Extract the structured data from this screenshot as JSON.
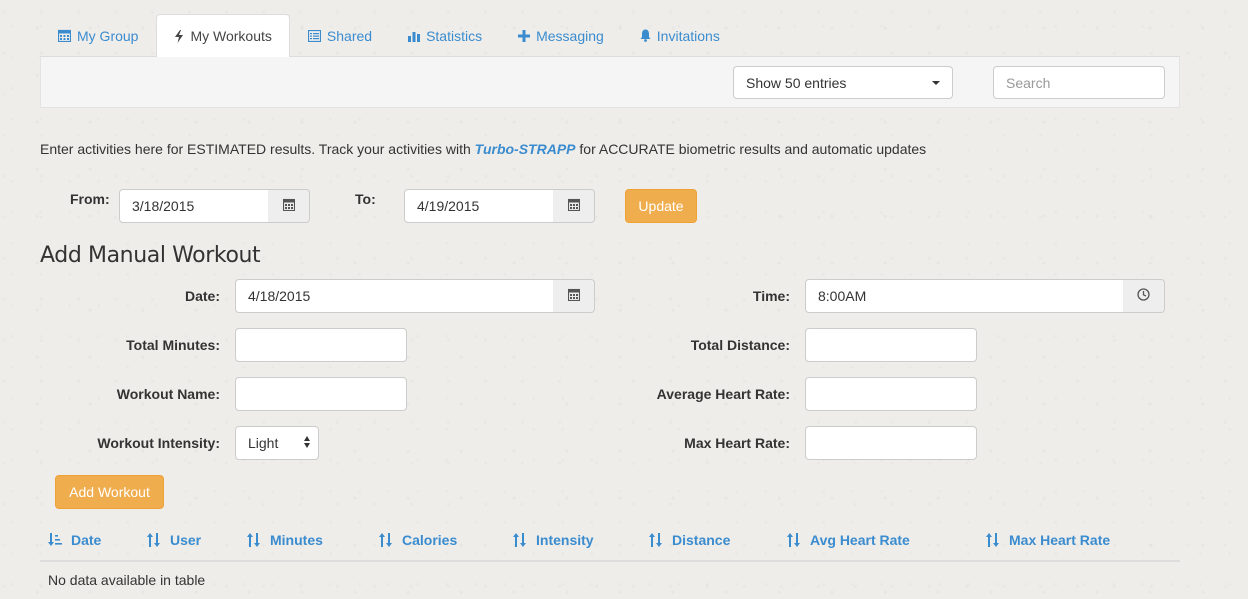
{
  "tabs": [
    {
      "label": "My Group",
      "icon": "calendar-icon"
    },
    {
      "label": "My Workouts",
      "icon": "bolt-icon",
      "active": true
    },
    {
      "label": "Shared",
      "icon": "list-icon"
    },
    {
      "label": "Statistics",
      "icon": "bar-chart-icon"
    },
    {
      "label": "Messaging",
      "icon": "plus-icon"
    },
    {
      "label": "Invitations",
      "icon": "bell-icon"
    }
  ],
  "filter": {
    "entries_selected": "Show 50 entries",
    "search_placeholder": "Search"
  },
  "intro": {
    "before": "Enter activities here for ESTIMATED results.  Track your activities with ",
    "brand": "Turbo-STRAPP",
    "after": " for ACCURATE biometric results and automatic updates"
  },
  "range": {
    "from_label": "From:",
    "from_value": "3/18/2015",
    "to_label": "To:",
    "to_value": "4/19/2015",
    "update_label": "Update"
  },
  "manual": {
    "title": "Add Manual Workout",
    "date_label": "Date:",
    "date_value": "4/18/2015",
    "time_label": "Time:",
    "time_value": "8:00AM",
    "total_minutes_label": "Total Minutes:",
    "total_minutes_value": "",
    "total_distance_label": "Total Distance:",
    "total_distance_value": "",
    "workout_name_label": "Workout Name:",
    "workout_name_value": "",
    "avg_hr_label": "Average Heart Rate:",
    "avg_hr_value": "",
    "intensity_label": "Workout Intensity:",
    "intensity_value": "Light",
    "max_hr_label": "Max Heart Rate:",
    "max_hr_value": "",
    "add_label": "Add Workout"
  },
  "table": {
    "columns": [
      "Date",
      "User",
      "Minutes",
      "Calories",
      "Intensity",
      "Distance",
      "Avg Heart Rate",
      "Max Heart Rate"
    ],
    "empty_text": "No data available in table"
  },
  "colors": {
    "link": "#3a8ccf",
    "warning": "#f0ad4e"
  }
}
